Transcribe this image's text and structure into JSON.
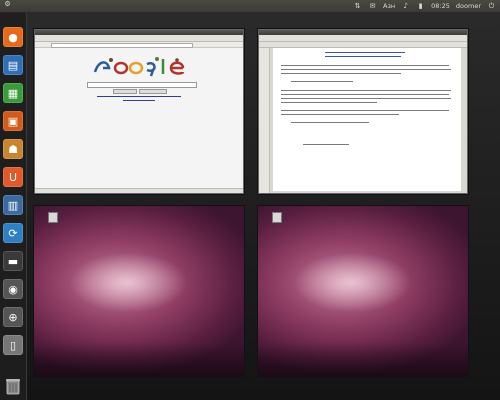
{
  "top_panel": {
    "left_icon": "power-gear-icon",
    "items": [
      {
        "name": "network-icon",
        "glyph": "⇅"
      },
      {
        "name": "messaging-icon",
        "glyph": "✉"
      },
      {
        "name": "keyboard-layout",
        "text": "Азн"
      },
      {
        "name": "volume-icon",
        "glyph": "♪"
      },
      {
        "name": "battery-icon",
        "glyph": "▮"
      }
    ],
    "clock": "08:25",
    "user": "doomer"
  },
  "launcher": {
    "items": [
      {
        "name": "firefox-launcher",
        "color": "#e66a1a",
        "glyph": "●"
      },
      {
        "name": "writer-launcher",
        "color": "#2f6fb5",
        "glyph": "▤"
      },
      {
        "name": "calc-launcher",
        "color": "#3b9a3a",
        "glyph": "▦"
      },
      {
        "name": "impress-launcher",
        "color": "#d45a1a",
        "glyph": "▣"
      },
      {
        "name": "software-center-launcher",
        "color": "#c9852e",
        "glyph": "☗"
      },
      {
        "name": "ubuntu-one-launcher",
        "color": "#e0592a",
        "glyph": "U"
      },
      {
        "name": "workspace-switcher-launcher",
        "color": "#3a6aa0",
        "glyph": "▥"
      },
      {
        "name": "update-manager-launcher",
        "color": "#2f7fc4",
        "glyph": "⟳"
      },
      {
        "name": "terminal-launcher",
        "color": "#3a3a3a",
        "glyph": "▬"
      },
      {
        "name": "dash-search-launcher",
        "color": "#555555",
        "glyph": "◉"
      },
      {
        "name": "search-launcher",
        "color": "#555555",
        "glyph": "⊕"
      },
      {
        "name": "usb-drive-launcher",
        "color": "#777777",
        "glyph": "▯"
      }
    ],
    "trash": "trash-icon"
  },
  "workspaces": [
    {
      "id": "ws1",
      "content": "browser"
    },
    {
      "id": "ws2",
      "content": "writer"
    },
    {
      "id": "ws3",
      "content": "empty"
    },
    {
      "id": "ws4",
      "content": "empty"
    }
  ],
  "browser": {
    "doodle": "Google",
    "doodle_colors": [
      "#2a5b9a",
      "#b3332a",
      "#e3a12b",
      "#2a5b9a",
      "#3c8a3a",
      "#b3332a"
    ]
  },
  "colors": {
    "panel": "#3c3b37",
    "launcher_bg": "#1e1e1e",
    "wallpaper_deep": "#5a1f40",
    "wallpaper_mid": "#8f3d63"
  }
}
